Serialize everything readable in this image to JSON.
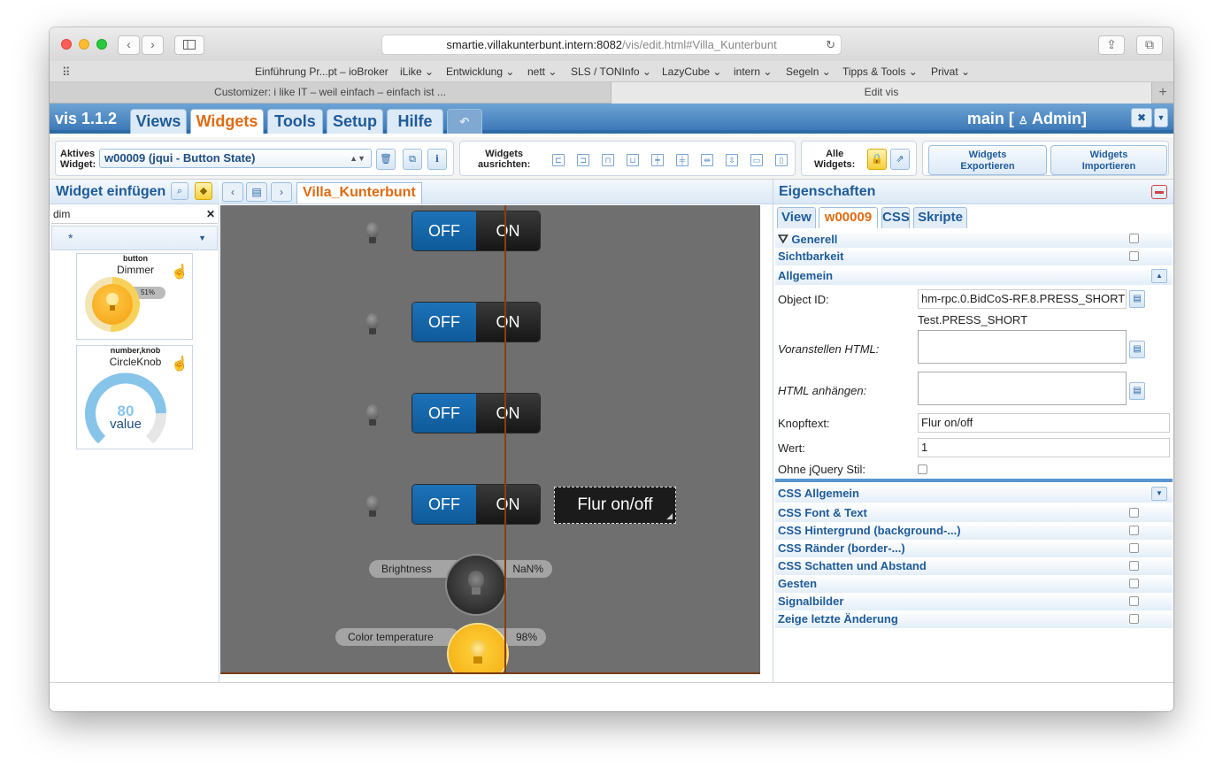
{
  "browser": {
    "url_host": "smartie.villakunterbunt.intern:8082",
    "url_path": "/vis/edit.html#Villa_Kunterbunt",
    "bookmarks": [
      "Einführung Pr...pt – ioBroker",
      "iLike ⌄",
      "Entwicklung ⌄",
      "nett ⌄",
      "SLS / TONInfo ⌄",
      "LazyCube ⌄",
      "intern ⌄",
      "Segeln ⌄",
      "Tipps & Tools ⌄",
      "Privat ⌄"
    ],
    "tabs": [
      "Customizer: i like IT – weil einfach – einfach ist ...",
      "Edit vis"
    ]
  },
  "vis": {
    "title": "vis 1.1.2",
    "menu": [
      "Views",
      "Widgets",
      "Tools",
      "Setup",
      "Hilfe"
    ],
    "undo_icon": "undo-icon",
    "project": "main [",
    "user": "Admin]"
  },
  "toolbar": {
    "active_label_1": "Aktives",
    "active_label_2": "Widget:",
    "active_widget": "w00009 (jqui - Button State)",
    "align_label_1": "Widgets",
    "align_label_2": "ausrichten:",
    "all_label_1": "Alle",
    "all_label_2": "Widgets:",
    "export_1": "Widgets",
    "export_2": "Exportieren",
    "import_1": "Widgets",
    "import_2": "Importieren"
  },
  "left": {
    "title": "Widget einfügen",
    "filter": "dim",
    "category": "*",
    "widgets": [
      {
        "category": "button",
        "name": "Dimmer",
        "percent": "51%"
      },
      {
        "category": "number,knob",
        "name": "CircleKnob",
        "value_num": "80",
        "value_label": "value"
      }
    ]
  },
  "center": {
    "view": "Villa_Kunterbunt",
    "switch_off": "OFF",
    "switch_on": "ON",
    "flur_button": "Flur on/off",
    "brightness_label": "Brightness",
    "brightness_value": "NaN%",
    "colortemp_label": "Color temperature",
    "colortemp_value": "98%"
  },
  "right": {
    "title": "Eigenschaften",
    "tabs": [
      "View",
      "w00009",
      "CSS",
      "Skripte"
    ],
    "sections_top": [
      "Generell",
      "Sichtbarkeit",
      "Allgemein"
    ],
    "object_id_label": "Object ID:",
    "object_id_value": "hm-rpc.0.BidCoS-RF.8.PRESS_SHORT",
    "object_id_name": "Test.PRESS_SHORT",
    "prepend_label": "Voranstellen HTML:",
    "append_label": "HTML anhängen:",
    "btntext_label": "Knopftext:",
    "btntext_value": "Flur on/off",
    "value_label": "Wert:",
    "value_value": "1",
    "nojquery_label": "Ohne jQuery Stil:",
    "sections_bottom": [
      "CSS Allgemein",
      "CSS Font & Text",
      "CSS Hintergrund (background-...)",
      "CSS Ränder (border-...)",
      "CSS Schatten und Abstand",
      "Gesten",
      "Signalbilder",
      "Zeige letzte Änderung"
    ]
  },
  "colors": {
    "accent_orange": "#e06a12",
    "header_blue": "#3d7ab8",
    "switch_blue": "#1d72b8"
  }
}
